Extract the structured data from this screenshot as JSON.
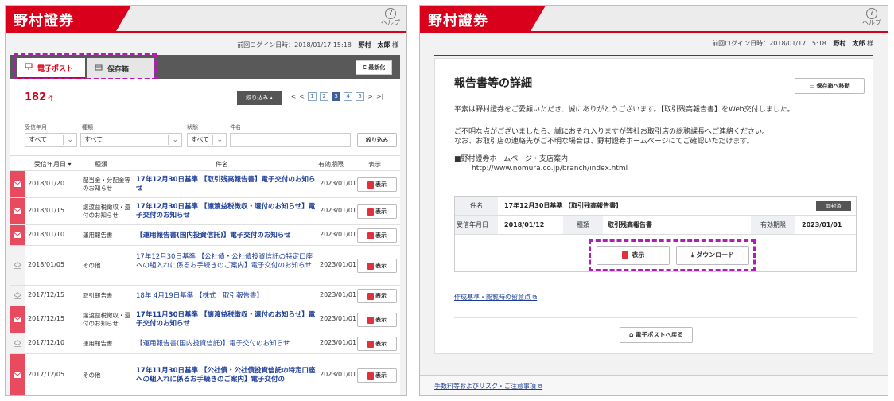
{
  "app": {
    "logo": "野村證券",
    "help": "ヘルプ",
    "help_symbol": "?"
  },
  "login": {
    "label": "前回ログイン日時：2018/01/17 15:18",
    "user": "野村　太郎",
    "suffix": "様"
  },
  "left": {
    "tabs": [
      {
        "label": "電子ポスト",
        "icon": "post-icon"
      },
      {
        "label": "保存箱",
        "icon": "box-icon"
      }
    ],
    "refresh": "C 最新化",
    "count": "182",
    "count_unit": "件",
    "filter_button": "絞り込み ▴",
    "pager": {
      "first": "|<",
      "prev": "<",
      "pages": [
        "1",
        "2",
        "3",
        "4",
        "5"
      ],
      "current": "3",
      "next": ">",
      "last": ">|"
    },
    "filters": {
      "labels": [
        "受信年月",
        "種類",
        "状態",
        "件名"
      ],
      "values": [
        "すべて",
        "すべて",
        "すべて",
        ""
      ],
      "submit": "絞り込み"
    },
    "columns": [
      "受信年月日 ▾",
      "種類",
      "件名",
      "有効期限",
      "表示"
    ],
    "rows": [
      {
        "unread": true,
        "date": "2018/01/20",
        "kind": "配当金・分配金等のお知らせ",
        "title": "17年12月30日基準 【取引残高報告書】電子交付のお知らせ",
        "bold": true,
        "expiry": "2023/01/01",
        "action": "表示"
      },
      {
        "unread": true,
        "date": "2018/01/15",
        "kind": "譲渡益税徴収・還付のお知らせ",
        "title": "17年12月30日基準 【譲渡益税徴収・還付のお知らせ】電子交付のお知らせ",
        "bold": true,
        "expiry": "2023/01/01",
        "action": "表示"
      },
      {
        "unread": true,
        "date": "2018/01/10",
        "kind": "運用報告書",
        "title": "【運用報告書(国内投資信託)】電子交付のお知らせ",
        "bold": true,
        "expiry": "2023/01/01",
        "action": "表示"
      },
      {
        "unread": false,
        "date": "2018/01/05",
        "kind": "その他",
        "title": "17年12月30日基準 【公社債・公社債投資信託の特定口座への組入れに係るお手続きのご案内】電子交付のお知らせ",
        "bold": false,
        "expiry": "2023/01/01",
        "action": "表示"
      },
      {
        "unread": false,
        "date": "2017/12/15",
        "kind": "取引報告書",
        "title": "18年 4月19日基準 【株式　取引報告書】",
        "bold": false,
        "expiry": "2023/01/01",
        "action": "表示"
      },
      {
        "unread": true,
        "date": "2017/12/15",
        "kind": "譲渡益税徴収・還付のお知らせ",
        "title": "17年11月30日基準 【譲渡益税徴収・還付のお知らせ】電子交付のお知らせ",
        "bold": true,
        "expiry": "2023/01/01",
        "action": "表示"
      },
      {
        "unread": false,
        "date": "2017/12/10",
        "kind": "運用報告書",
        "title": "【運用報告書(国内投資信託)】電子交付のお知らせ",
        "bold": false,
        "expiry": "2023/01/01",
        "action": "表示"
      },
      {
        "unread": true,
        "date": "2017/12/05",
        "kind": "その他",
        "title": "17年11月30日基準 【公社債・公社債投資信託の特定口座への組入れに係るお手続きのご案内】電子交付の",
        "bold": true,
        "expiry": "2023/01/01",
        "action": "表示"
      }
    ]
  },
  "right": {
    "heading": "報告書等の詳細",
    "move_button": "保存箱へ移動",
    "intro": "平素は野村證券をご愛顧いただき、誠にありがとうございます。【取引残高報告書】をWeb交付しました。",
    "contact1": "ご不明な点がございましたら、誠におそれ入りますが弊社お取引店の総務課長へご連絡ください。",
    "contact2": "なお、お取引店の連絡先がご不明な場合は、野村證券ホームページにてご確認いただけます。",
    "site_label": "■野村證券ホームページ・支店案内",
    "site_url": "http://www.nomura.co.jp/branch/index.html",
    "detail": {
      "subject_label": "件名",
      "subject": "17年12月30日基準 【取引残高報告書】",
      "status": "開封済",
      "received_label": "受信年月日",
      "received": "2018/01/12",
      "kind_label": "種類",
      "kind": "取引残高報告書",
      "expiry_label": "有効期限",
      "expiry": "2023/01/01",
      "show_button": "表示",
      "download_button": "ダウンロード"
    },
    "notes_link": "作成基準・閲覧時の留意点",
    "back_button": "電子ポストへ戻る",
    "footer_link": "手数料等およびリスク・ご注意事項"
  },
  "colors": {
    "brand": "#d9001b",
    "unread": "#e84a5f",
    "link": "#1b3d96",
    "highlight": "#b01db5"
  }
}
